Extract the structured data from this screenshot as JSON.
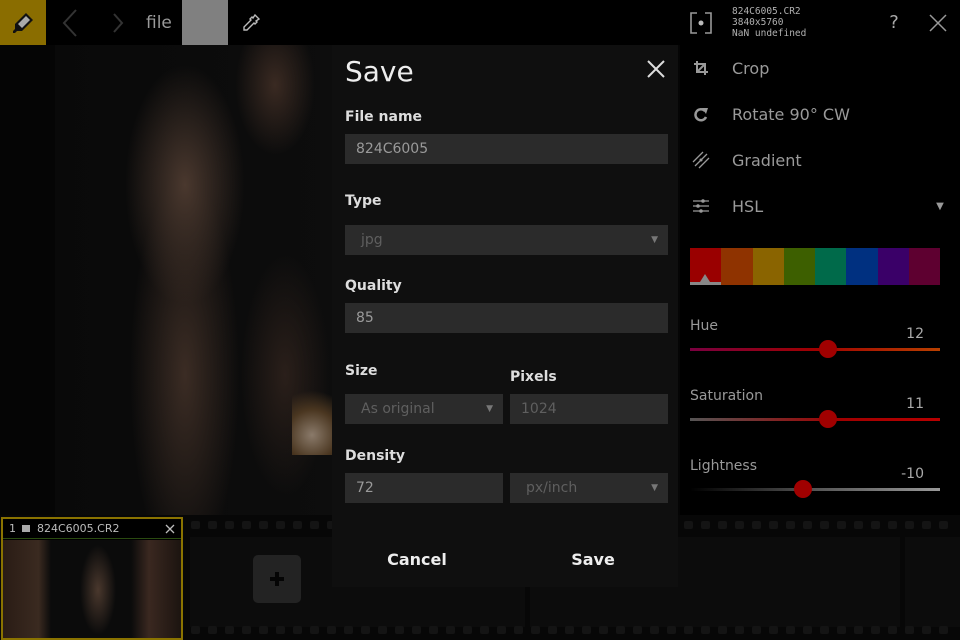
{
  "toolbar": {
    "file_label": "file",
    "swatch_color": "#808080",
    "accent_color": "#8a6d00"
  },
  "filmstrip": {
    "thumb_index": "1",
    "thumb_name": "824C6005.CR2"
  },
  "panel": {
    "file_name": "824C6005.CR2",
    "dimensions": "3840x5760",
    "meta": "NaN undefined",
    "help_label": "?",
    "tools": [
      {
        "label": "Crop",
        "icon": "crop-icon"
      },
      {
        "label": "Rotate 90° CW",
        "icon": "rotate-cw-icon"
      },
      {
        "label": "Gradient",
        "icon": "gradient-icon"
      },
      {
        "label": "HSL",
        "icon": "sliders-icon"
      }
    ],
    "hsl_swatches": [
      {
        "name": "red",
        "color": "#9a0000",
        "selected": true
      },
      {
        "name": "orange",
        "color": "#8f3300"
      },
      {
        "name": "yellow",
        "color": "#8a6400"
      },
      {
        "name": "green",
        "color": "#3d5f00"
      },
      {
        "name": "aqua",
        "color": "#006a4a"
      },
      {
        "name": "blue",
        "color": "#003080"
      },
      {
        "name": "purple",
        "color": "#3a0068"
      },
      {
        "name": "magenta",
        "color": "#5e0030"
      }
    ],
    "sliders": [
      {
        "label": "Hue",
        "value": "12",
        "position": 0.55
      },
      {
        "label": "Saturation",
        "value": "11",
        "position": 0.55
      },
      {
        "label": "Lightness",
        "value": "-10",
        "position": 0.45
      }
    ]
  },
  "dialog": {
    "title": "Save",
    "file_name_label": "File name",
    "file_name_value": "824C6005",
    "type_label": "Type",
    "type_value": "jpg",
    "quality_label": "Quality",
    "quality_value": "85",
    "size_label": "Size",
    "size_value": "As original",
    "pixels_label": "Pixels",
    "pixels_value": "1024",
    "density_label": "Density",
    "density_value": "72",
    "density_unit": "px/inch",
    "cancel_label": "Cancel",
    "save_label": "Save"
  }
}
